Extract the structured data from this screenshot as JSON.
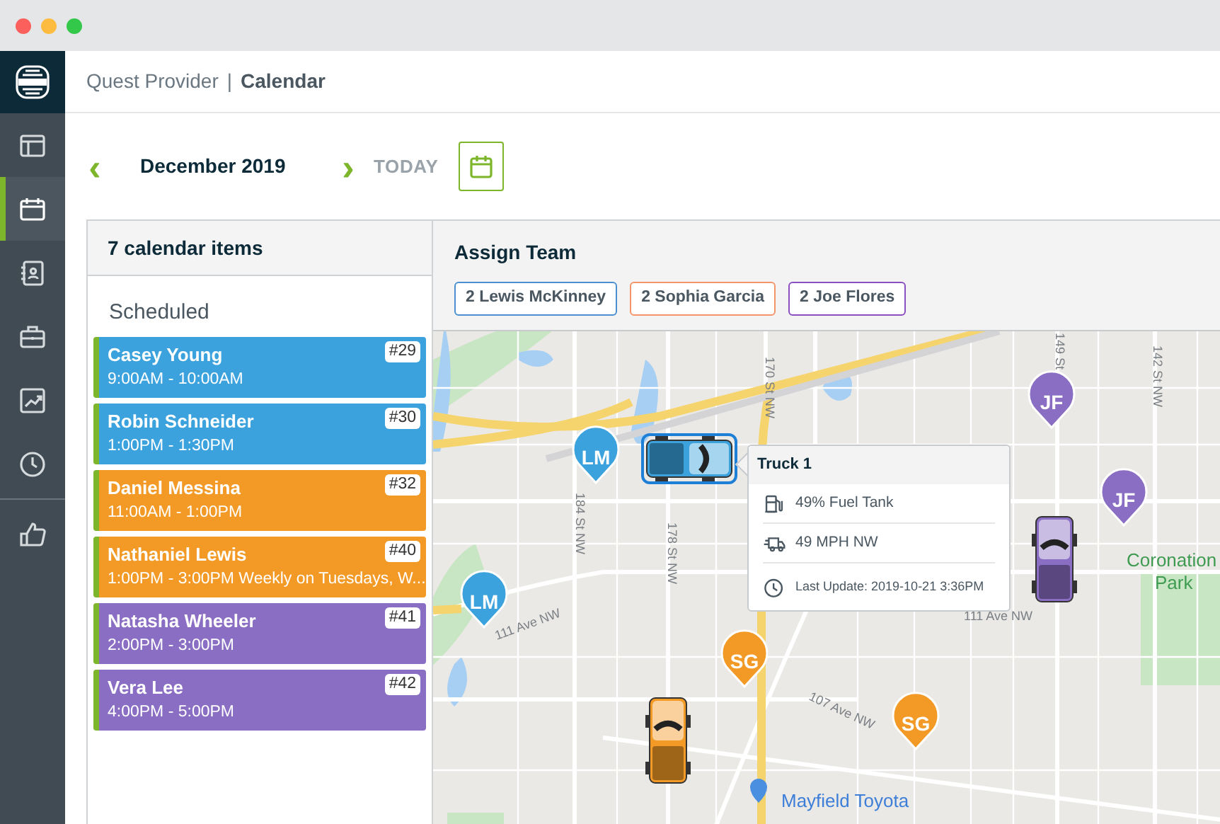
{
  "window": {
    "controls": [
      {
        "color": "#fc605c"
      },
      {
        "color": "#fdbc40"
      },
      {
        "color": "#34c84a"
      }
    ]
  },
  "sidebar": {
    "items": [
      {
        "kind": "dashboard",
        "selected": false
      },
      {
        "kind": "calendar",
        "selected": true
      },
      {
        "kind": "contacts",
        "selected": false
      },
      {
        "kind": "work",
        "selected": false
      },
      {
        "kind": "reports",
        "selected": false
      },
      {
        "kind": "timesheets",
        "selected": false
      },
      {
        "kind": "feedback",
        "selected": false
      }
    ]
  },
  "header": {
    "breadcrumb": "Quest Provider",
    "separator": "|",
    "title": "Calendar"
  },
  "nav": {
    "prev": "‹",
    "month": "December 2019",
    "next": "›",
    "today": "TODAY"
  },
  "calendar_list": {
    "title": "7 calendar items",
    "section": "Scheduled",
    "items": [
      {
        "name": "Casey Young",
        "time": "9:00AM - 10:00AM",
        "number": "#29",
        "color": "#3ba2de"
      },
      {
        "name": "Robin Schneider",
        "time": "1:00PM - 1:30PM",
        "number": "#30",
        "color": "#3ba2de"
      },
      {
        "name": "Daniel Messina",
        "time": "11:00AM - 1:00PM",
        "number": "#32",
        "color": "#f39a26"
      },
      {
        "name": "Nathaniel Lewis",
        "time": "1:00PM - 3:00PM Weekly on Tuesdays, W...",
        "number": "#40",
        "color": "#f39a26"
      },
      {
        "name": "Natasha Wheeler",
        "time": "2:00PM - 3:00PM",
        "number": "#41",
        "color": "#8a6ec3"
      },
      {
        "name": "Vera Lee",
        "time": "4:00PM - 5:00PM",
        "number": "#42",
        "color": "#8a6ec3"
      }
    ]
  },
  "assign_team": {
    "title": "Assign Team",
    "members": [
      {
        "label": "2 Lewis McKinney",
        "color": "#4a90d0"
      },
      {
        "label": "2 Sophia Garcia",
        "color": "#f4946a"
      },
      {
        "label": "2 Joe Flores",
        "color": "#8a4fc0"
      }
    ]
  },
  "map": {
    "labels": [
      "184 St NW",
      "178 St NW",
      "170 St NW",
      "149 St",
      "142 St NW",
      "111 Ave NW",
      "111 Ave NW",
      "107 Ave NW",
      "Coronation",
      "Park",
      "Mayfield Toyota"
    ],
    "pins": [
      {
        "initials": "LM",
        "color": "#3ba2de"
      },
      {
        "initials": "LM",
        "color": "#3ba2de"
      },
      {
        "initials": "SG",
        "color": "#f39a26"
      },
      {
        "initials": "SG",
        "color": "#f39a26"
      },
      {
        "initials": "JF",
        "color": "#8a6ec3"
      },
      {
        "initials": "JF",
        "color": "#8a6ec3"
      }
    ],
    "trucks": [
      {
        "color": "#3ba2de",
        "selected": true
      },
      {
        "color": "#8a6ec3",
        "selected": false
      },
      {
        "color": "#f39a26",
        "selected": false
      }
    ],
    "popup": {
      "title": "Truck 1",
      "rows": [
        {
          "kind": "fuel",
          "text": "49% Fuel Tank"
        },
        {
          "kind": "speed",
          "text": "49 MPH NW"
        },
        {
          "kind": "clock",
          "text": "Last Update: 2019-10-21 3:36PM"
        }
      ]
    }
  }
}
